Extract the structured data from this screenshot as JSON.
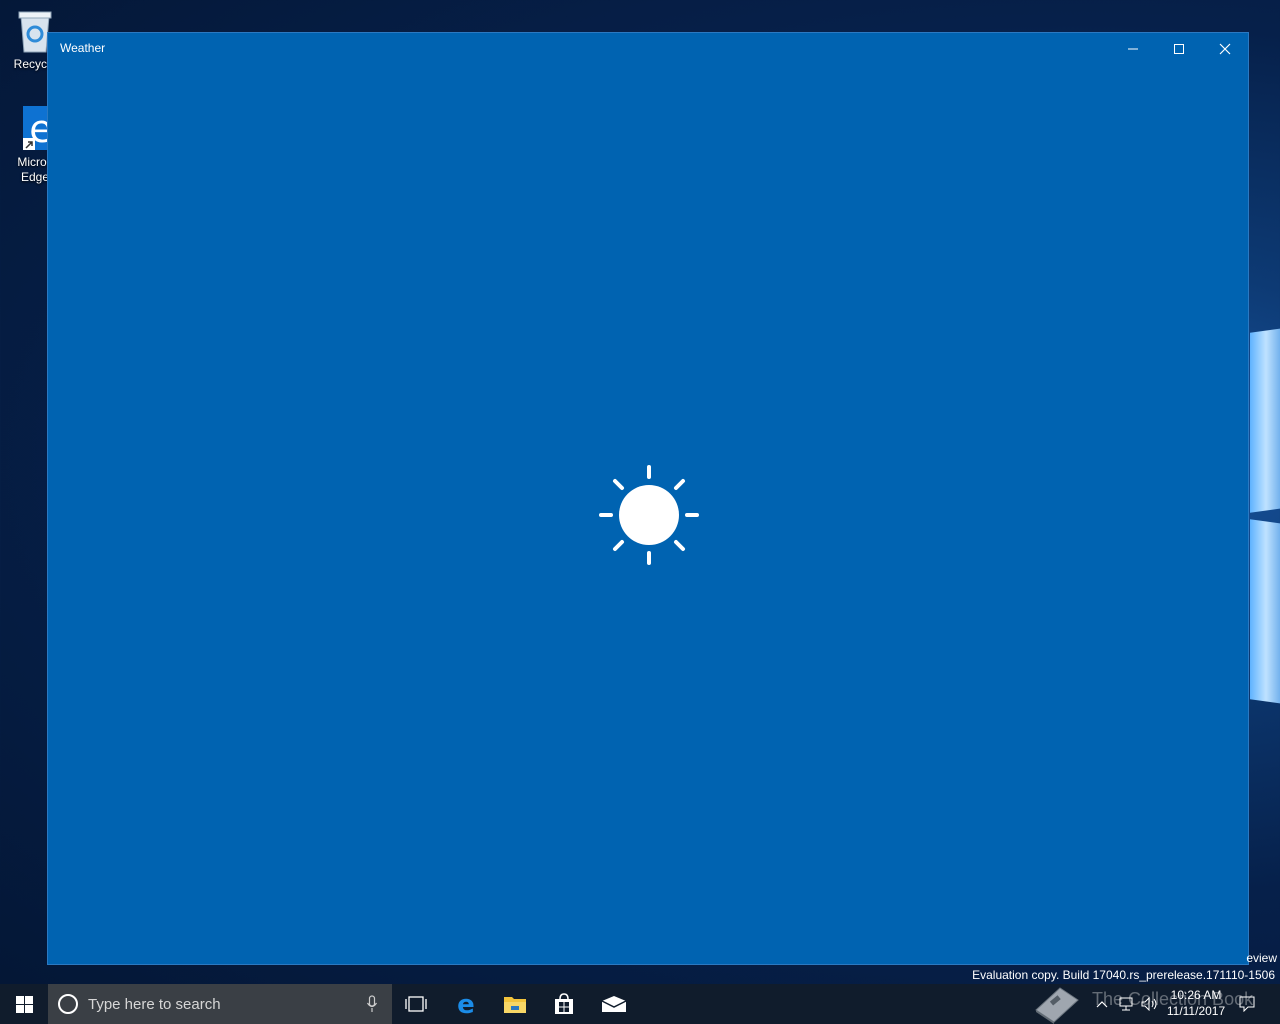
{
  "desktop": {
    "icons": [
      {
        "label": "Recycle"
      },
      {
        "label1": "Micros",
        "label2": "Edge"
      }
    ]
  },
  "window": {
    "title": "Weather"
  },
  "watermark": {
    "line1": "eview",
    "line2": "Evaluation copy. Build 17040.rs_prerelease.171110-1506"
  },
  "taskbar": {
    "search_placeholder": "Type here to search",
    "brand_text": "The Collection Book",
    "time": "10:26 AM",
    "date": "11/11/2017"
  },
  "colors": {
    "window_bg": "#0063b1",
    "taskbar_bg": "#101c2c"
  }
}
